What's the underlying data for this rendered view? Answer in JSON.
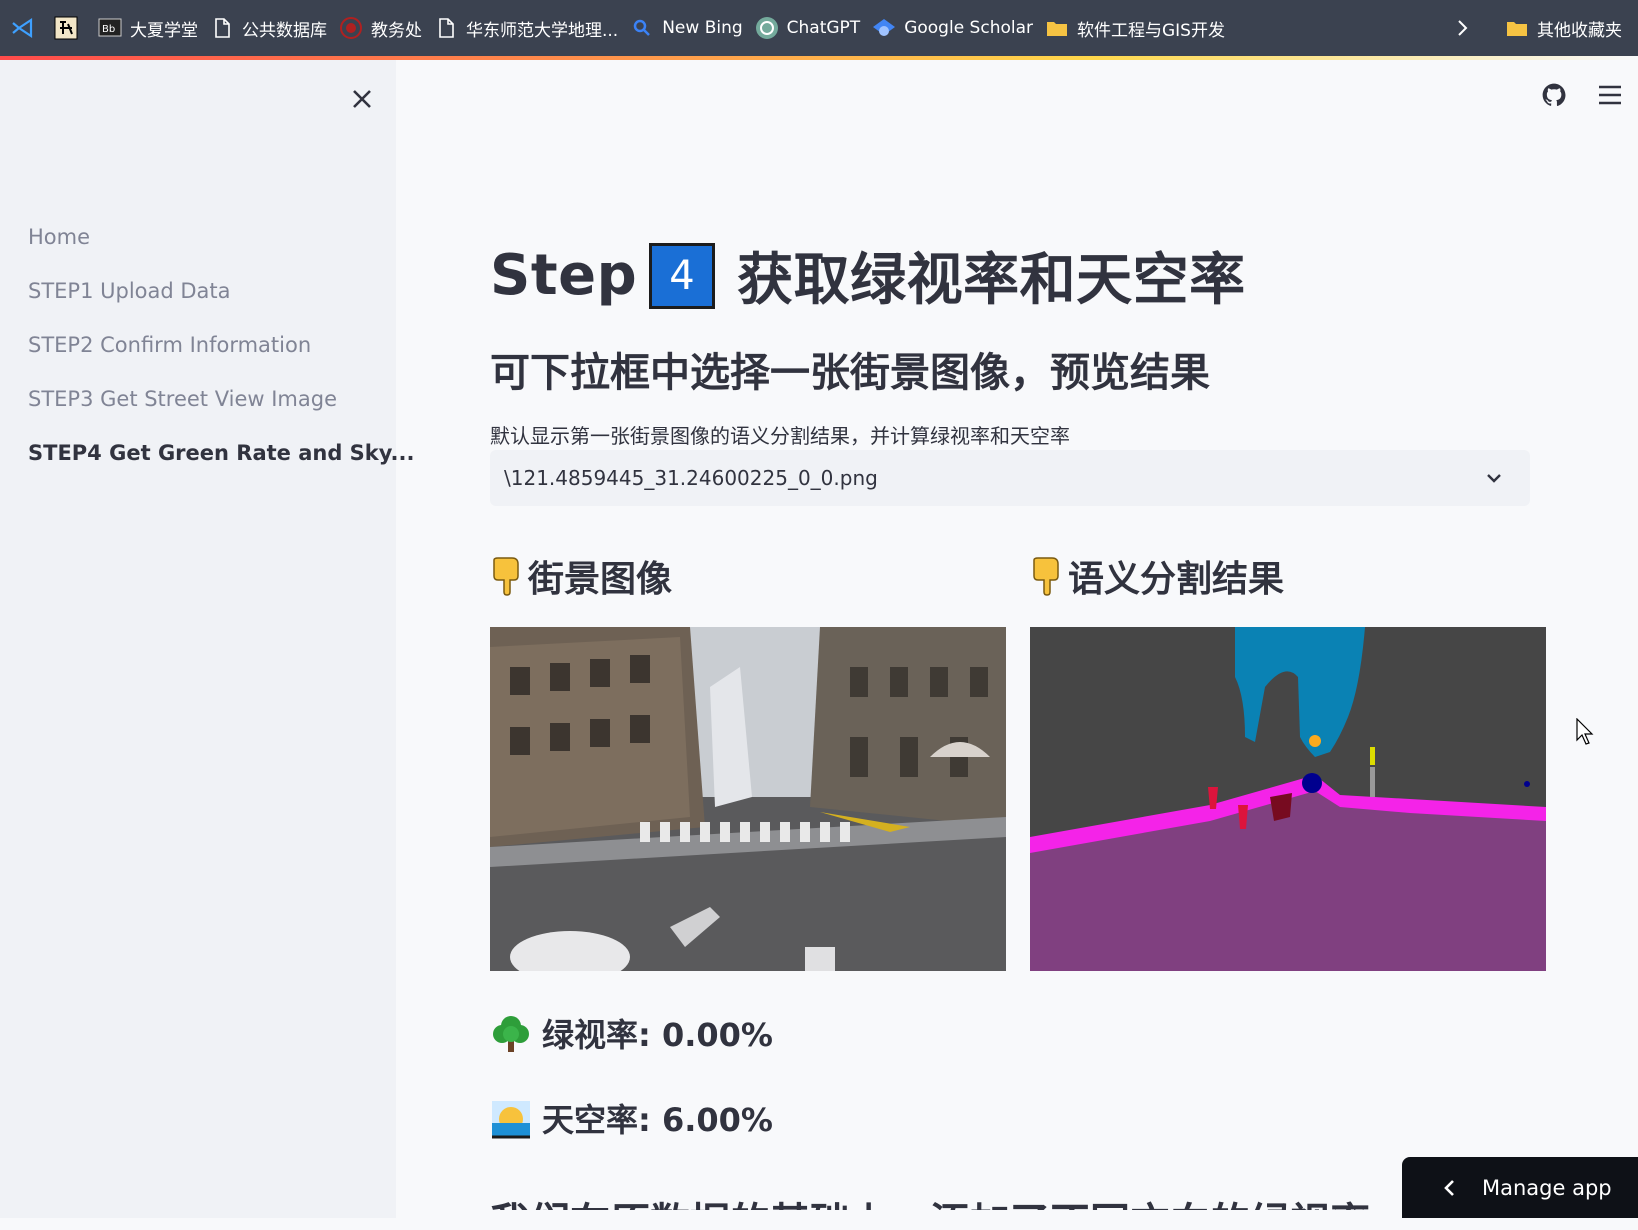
{
  "bookmarks": [
    {
      "label": "",
      "icon": "vscode-icon"
    },
    {
      "label": "",
      "icon": "zhi-icon"
    },
    {
      "label": "大夏学堂",
      "icon": "blackboard-icon"
    },
    {
      "label": "公共数据库",
      "icon": "document-icon"
    },
    {
      "label": "教务处",
      "icon": "seal-icon"
    },
    {
      "label": "华东师范大学地理...",
      "icon": "document-icon"
    },
    {
      "label": "New Bing",
      "icon": "search-icon"
    },
    {
      "label": "ChatGPT",
      "icon": "chatgpt-icon"
    },
    {
      "label": "Google Scholar",
      "icon": "scholar-icon"
    },
    {
      "label": "软件工程与GIS开发",
      "icon": "folder-icon"
    }
  ],
  "bookmarks_other": "其他收藏夹",
  "sidebar": {
    "items": [
      {
        "label": "Home",
        "active": false
      },
      {
        "label": "STEP1 Upload Data",
        "active": false
      },
      {
        "label": "STEP2 Confirm Information",
        "active": false
      },
      {
        "label": "STEP3 Get Street View Image",
        "active": false
      },
      {
        "label": "STEP4 Get Green Rate and Sky...",
        "active": true
      }
    ]
  },
  "main": {
    "title_prefix": "Step",
    "title_badge": "4",
    "title_suffix": "获取绿视率和天空率",
    "subtitle": "可下拉框中选择一张街景图像，预览结果",
    "description": "默认显示第一张街景图像的语义分割结果，并计算绿视率和天空率",
    "select_value": "\\121.4859445_31.24600225_0_0.png",
    "col1_title": "街景图像",
    "col2_title": "语义分割结果",
    "green_rate_label": "绿视率: 0.00%",
    "sky_rate_label": "天空率: 6.00%",
    "cut_text": "我们在原数据的基础上，添加了不同方向的绿视率、天空率"
  },
  "manage_app": "Manage app",
  "colors": {
    "accent": "#ff4b4b",
    "badge_blue": "#1a6fd6",
    "seg_road": "#804080",
    "seg_sidewalk": "#f423e8",
    "seg_building": "#464646",
    "seg_sky": "#0a82b4"
  }
}
